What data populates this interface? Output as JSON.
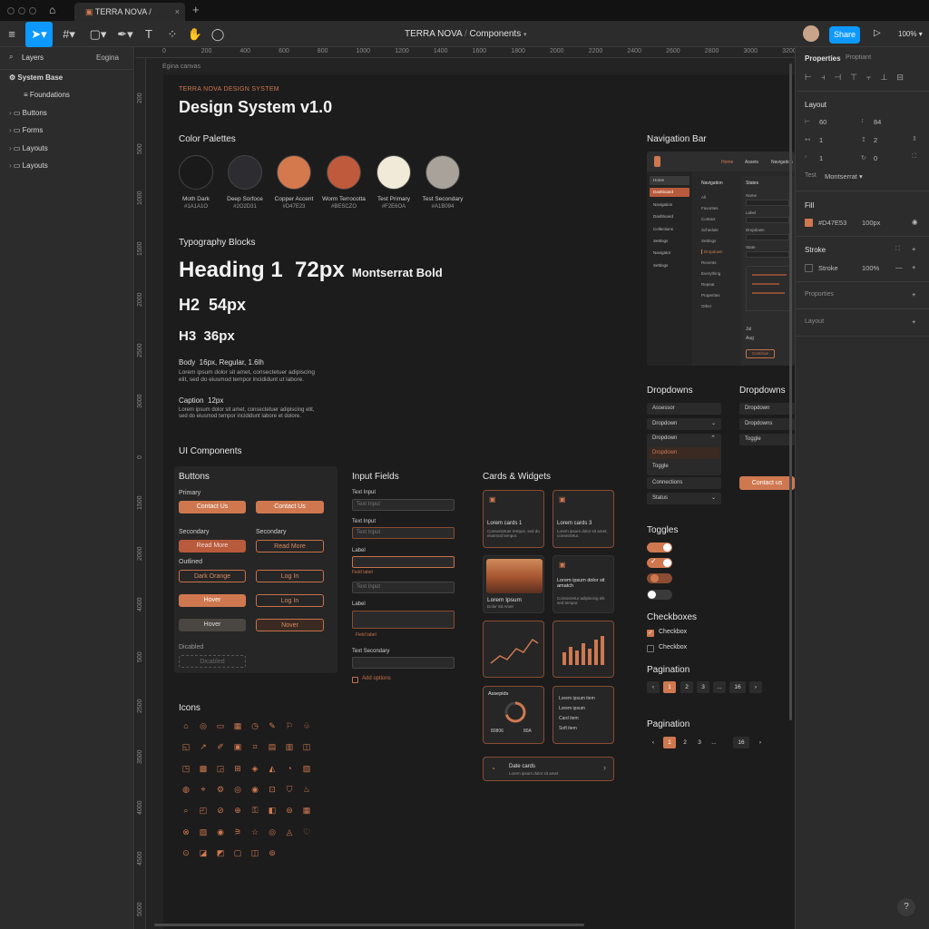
{
  "window": {
    "tab_title": "TERRA NOVA / Components",
    "new_tab": "+"
  },
  "toolbar": {
    "file_title": "TERRA NOVA",
    "page_title": "Components",
    "share_label": "Share",
    "zoom": "100%"
  },
  "rulers": {
    "top": [
      "0",
      "200",
      "400",
      "600",
      "800",
      "1000",
      "1200",
      "1400",
      "1600",
      "1800",
      "2000",
      "2200",
      "2400",
      "2600",
      "2800",
      "3000",
      "3200"
    ],
    "left": [
      "200",
      "500",
      "1000",
      "1500",
      "2000",
      "2500",
      "3000",
      "0",
      "1500",
      "2000",
      "4000",
      "500",
      "2500",
      "3500",
      "4000",
      "4500",
      "5000"
    ]
  },
  "layers": {
    "tab_layers": "Layers",
    "tab_pages": "Eogina",
    "items": [
      "System Base",
      "Foundations",
      "Buttons",
      "Forms",
      "Layouts",
      "Layouts"
    ]
  },
  "canvas": {
    "frame_label": "Egina canvas"
  },
  "design": {
    "overline": "TERRA NOVA DESIGN SYSTEM",
    "title": "Design System v1.0",
    "color_heading": "Color Palettes",
    "swatches": [
      {
        "name": "Moth Dark",
        "hex": "#1A1A1O",
        "color": "#1a1a1a"
      },
      {
        "name": "Deep Sorfoce",
        "hex": "#2O2D31",
        "color": "#2d2d31"
      },
      {
        "name": "Copper Accent",
        "hex": "#D47E23",
        "color": "#d4784e"
      },
      {
        "name": "Worm Terrocotta",
        "hex": "#BESCZO",
        "color": "#c05a3c"
      },
      {
        "name": "Test Primary",
        "hex": "#F2E6OA",
        "color": "#f2ead8"
      },
      {
        "name": "Test Secondary",
        "hex": "#A1B094",
        "color": "#a8a29a"
      }
    ],
    "typography_heading": "Typography Blocks",
    "h1": "Heading 1  72px",
    "h1_font": "Montserrat Bold",
    "h2": "H2  54px",
    "h3": "H3  36px",
    "body_label": "Body  16px, Regular, 1.6lh",
    "body_text1": "Lorem ipsum dolor sit amet, consectetuer adipiscing",
    "body_text2": "elit, sed do eiusmod tempor incididunt ut labore.",
    "caption_label": "Caption  12px",
    "caption_text1": "Lorem ipsum dolor sit amet, consectetuer adipiscing elit,",
    "caption_text2": "sed do eiusmod tempor incididunt labore et dolore.",
    "ui_heading": "UI Components",
    "buttons": {
      "heading": "Buttons",
      "primary": "Primary",
      "contact": "Contact Us",
      "secondary": "Secondary",
      "read_more": "Read More",
      "outlined": "Outlined",
      "dark_orange": "Dark Orange",
      "log_in": "Log In",
      "hover": "Hover",
      "hover2": "Nover",
      "disabled": "Dicabled",
      "disabled_btn": "Dicabled"
    },
    "inputs": {
      "heading": "Input Fields",
      "l1": "Text Input",
      "p1": "Text Input",
      "l2": "Text Input",
      "p2": "Text Input",
      "l3": "Label",
      "err1": "Field label",
      "p4": "Text Input",
      "l4": "Label",
      "err2": "Field label",
      "l5": "Text Secondary",
      "check": "Add options"
    },
    "cards": {
      "heading": "Cards & Widgets",
      "c1_title": "Lorem cards 1",
      "c1_text": "Consectetuer tempor, sed do eiusmod tempor.",
      "c2_title": "Lorem cards 3",
      "c2_text": "Lorem ipsum dolor sit amet, consectetur.",
      "c3_title": "Lorem Ipsum",
      "c3_text": "Dolor Sit Amet",
      "c4_title": "Lorem ipsum dolor sit amatch",
      "c4_text": "Consectetur adipiscing elit sed tempor.",
      "c7_title": "Assepids",
      "c7_v1": "80806",
      "c7_v2": "80A",
      "c8_items": [
        "Lorem ipsum item",
        "Lorem ipsum",
        "Card item",
        "Soft item"
      ],
      "c9_title": "Date cards",
      "c9_text": "Lorem ipsum dolor sit amet"
    },
    "icons_heading": "Icons",
    "icons": [
      "⌂",
      "◎",
      "▭",
      "▦",
      "◷",
      "✎",
      "⚐",
      "♧",
      "◱",
      "↗",
      "✐",
      "▣",
      "⌗",
      "▤",
      "▥",
      "◫",
      "◳",
      "▩",
      "◲",
      "⊞",
      "◈",
      "◭",
      "◔",
      "▧",
      "◍",
      "⌖",
      "⚙",
      "◎",
      "◉",
      "⊡",
      "⛉",
      "♨",
      "⌕",
      "◰",
      "⊘",
      "⊕",
      "⚿",
      "◧",
      "⊜",
      "▦",
      "⊗",
      "▨",
      "◉",
      "⚞",
      "☆",
      "◎",
      "◬",
      "♡",
      "⊙",
      "◪",
      "◩",
      "▢",
      "◫",
      "⊚"
    ],
    "navbar": {
      "heading": "Navigation Bar",
      "top_items": [
        "Home",
        "Assets",
        "Navigation"
      ],
      "side": [
        "Home",
        "Dashboard",
        "Navigation",
        "Dashboard",
        "Collections",
        "Settings",
        "Navigator",
        "Settings"
      ],
      "col2_title": "Navigation",
      "col2": [
        "All",
        "Favorites",
        "Contact",
        "Schedule",
        "Settings",
        "Dropdown",
        "Recents",
        "Everything",
        "Repeat",
        "Properties",
        "Other"
      ],
      "col3_title": "States",
      "col3": [
        "Name",
        "Label",
        "Dropdown",
        "State"
      ],
      "foot": [
        "Jul",
        "Aug"
      ],
      "btn": "Continue"
    },
    "dropdowns": {
      "heading": "Dropdowns",
      "heading2": "Dropdowns",
      "items": [
        "Assessor",
        "Dropdown",
        "Dropdown",
        "Dropdown",
        "Toggle",
        "Connections",
        "Status"
      ],
      "items2": [
        "Dropdown",
        "Dropdowns",
        "Toggle"
      ],
      "cta": "Contact us"
    },
    "toggles_heading": "Toggles",
    "checkboxes_heading": "Checkboxes",
    "checkbox1": "Checkbox",
    "checkbox2": "Checkbox",
    "pagination_heading": "Pagination",
    "pagination_heading2": "Pagination",
    "pages": [
      "1",
      "2",
      "3",
      "...",
      "16"
    ]
  },
  "properties": {
    "tab1": "Properties",
    "tab2": "Proptiant",
    "layout": "Layout",
    "w": "60",
    "h": "84",
    "x": "1",
    "y": "2",
    "r1": "1",
    "r2": "0",
    "text_label": "Test",
    "font": "Montserrat",
    "fill": "Fill",
    "fill_hex": "#D47E53",
    "fill_opacity": "100px",
    "fill_color": "#cf7850",
    "stroke": "Stroke",
    "stroke_label": "Stroke",
    "stroke_val": "100%",
    "presets": "Proporties",
    "layout2": "Layout"
  }
}
